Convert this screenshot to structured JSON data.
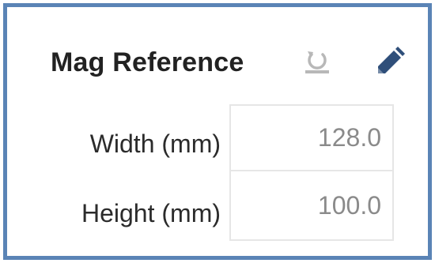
{
  "panel": {
    "title": "Mag Reference",
    "reset_icon": "reset-icon",
    "edit_icon": "pencil-icon",
    "accent_color": "#5a84b6"
  },
  "fields": {
    "width": {
      "label": "Width (mm)",
      "value": "128.0"
    },
    "height": {
      "label": "Height (mm)",
      "value": "100.0"
    }
  }
}
